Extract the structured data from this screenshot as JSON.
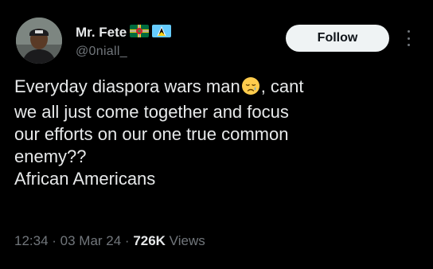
{
  "author": {
    "display_name": "Mr. Fete",
    "handle": "@0niall_",
    "flags": [
      "flag-icon-dominica",
      "flag-icon-saint-lucia"
    ]
  },
  "follow_label": "Follow",
  "tweet": {
    "line1_before_emoji": "Everyday diaspora wars man",
    "emoji": "sad-but-relieved-face-icon",
    "line1_after_emoji": ", cant",
    "line2": "we all just come together and focus",
    "line3": "our efforts on our one true common",
    "line4": "enemy??",
    "line5": "African Americans"
  },
  "meta": {
    "time": "12:34",
    "sep1": " · ",
    "date": "03 Mar 24",
    "sep2": " · ",
    "views_count": "726K",
    "views_label": " Views"
  },
  "colors": {
    "background": "#000000",
    "text": "#e7e9ea",
    "secondary": "#71767b",
    "button_bg": "#eff3f4"
  }
}
